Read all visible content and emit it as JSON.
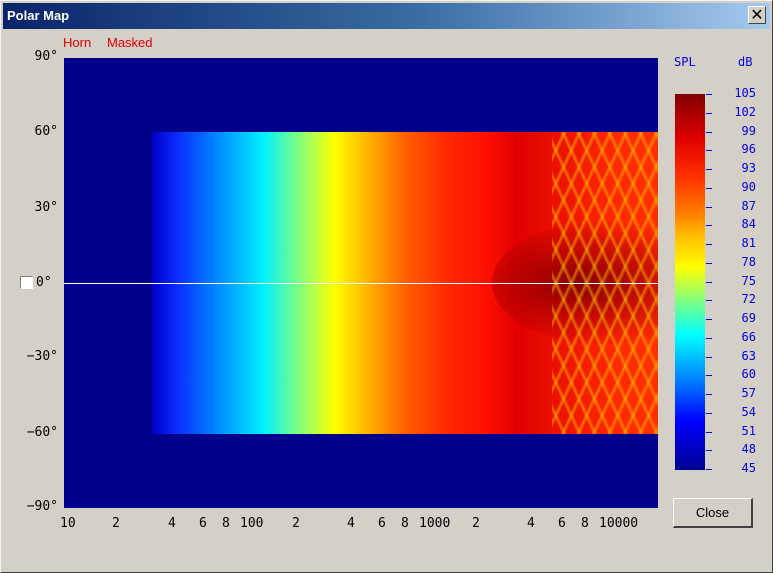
{
  "window": {
    "title": "Polar Map",
    "close_glyph": "✕"
  },
  "labels": {
    "horn": "Horn",
    "masked": "Masked"
  },
  "checkbox": {
    "checked": false
  },
  "chart_data": {
    "type": "heatmap",
    "title": "",
    "y_axis": {
      "ticks": [
        "90°",
        "60°",
        "30°",
        "0°",
        "−30°",
        "−60°",
        "−90°"
      ],
      "range": [
        -90,
        90
      ]
    },
    "x_axis": {
      "scale": "log",
      "range": [
        10,
        20000
      ],
      "ticks": [
        "10",
        "2",
        "4",
        "6",
        "8",
        "100",
        "2",
        "4",
        "6",
        "8",
        "1000",
        "2",
        "4",
        "6",
        "8",
        "10000"
      ]
    },
    "legend": {
      "title": "SPL",
      "unit": "dB",
      "placement": "right",
      "values": [
        "105",
        "102",
        "99",
        "96",
        "93",
        "90",
        "87",
        "84",
        "81",
        "78",
        "75",
        "72",
        "69",
        "66",
        "63",
        "60",
        "57",
        "54",
        "51",
        "48",
        "45"
      ]
    },
    "colormap": [
      "#800000",
      "#ff0000",
      "#ff8000",
      "#ffff00",
      "#00ffff",
      "#0000ff",
      "#00008b"
    ]
  },
  "buttons": {
    "close": "Close"
  }
}
